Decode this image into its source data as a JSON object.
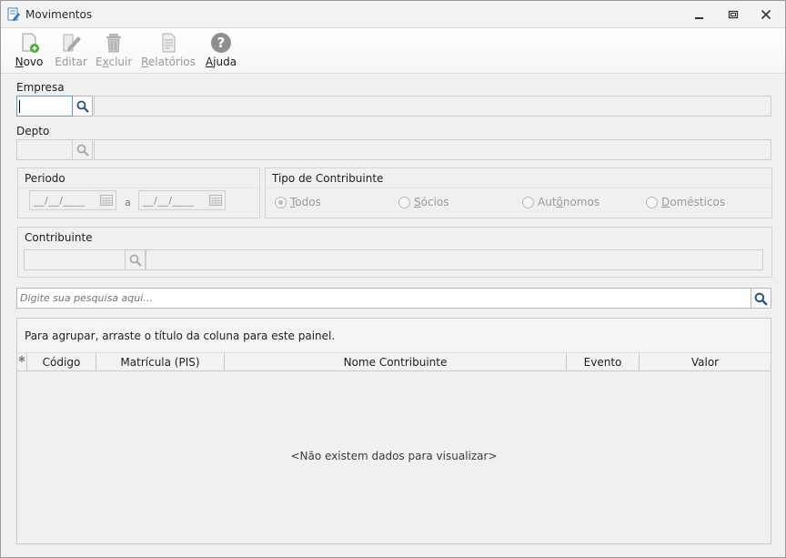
{
  "window": {
    "title": "Movimentos",
    "icon": "document-edit-icon",
    "controls": [
      "minimize-icon",
      "restore-icon",
      "close-icon"
    ]
  },
  "toolbar": {
    "novo": {
      "pre": "",
      "key": "N",
      "post": "ovo",
      "icon": "new-document-icon",
      "enabled": true
    },
    "editar": {
      "pre": "",
      "key": "",
      "post": "Editar",
      "icon": "pencil-icon",
      "enabled": false
    },
    "excluir": {
      "pre": "E",
      "key": "x",
      "post": "cluir",
      "icon": "trash-icon",
      "enabled": false
    },
    "relatorios": {
      "pre": "",
      "key": "R",
      "post": "elatórios",
      "icon": "report-icon",
      "enabled": false
    },
    "ajuda": {
      "pre": "",
      "key": "A",
      "post": "juda",
      "icon": "help-icon",
      "enabled": true
    }
  },
  "empresa": {
    "label": "Empresa",
    "code": "",
    "name": ""
  },
  "depto": {
    "label": "Depto",
    "code": "",
    "name": ""
  },
  "periodo": {
    "title": "Periodo",
    "start": "__/__/____",
    "separator": "a",
    "end": "__/__/____"
  },
  "tipo_contribuinte": {
    "title": "Tipo de Contribuinte",
    "options": [
      {
        "key": "T",
        "rest": "odos",
        "selected": true
      },
      {
        "key": "S",
        "rest": "ócios",
        "selected": false
      },
      {
        "pre": "Aut",
        "key": "ô",
        "rest": "nomos",
        "selected": false
      },
      {
        "key": "D",
        "rest": "omésticos",
        "selected": false
      }
    ]
  },
  "contribuinte": {
    "title": "Contribuinte",
    "code": "",
    "name": ""
  },
  "search": {
    "placeholder": "Digite sua pesquisa aqui..."
  },
  "grid": {
    "group_panel_text": "Para agrupar, arraste o título da coluna para este painel.",
    "columns": [
      "Código",
      "Matrícula (PIS)",
      "Nome Contribuinte",
      "Evento",
      "Valor"
    ],
    "rows": [],
    "empty_text": "<Não existem dados para visualizar>"
  }
}
